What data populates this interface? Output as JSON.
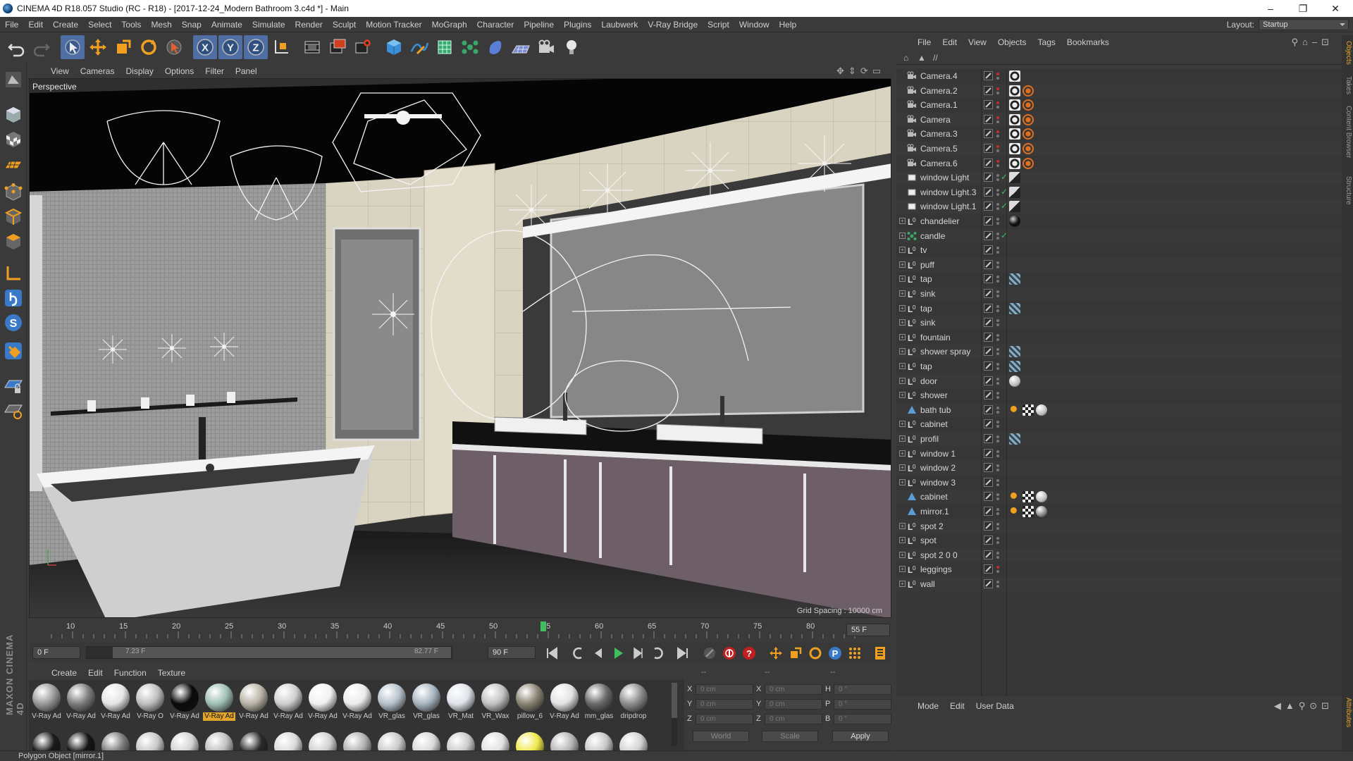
{
  "window": {
    "title": "CINEMA 4D R18.057 Studio (RC - R18) - [2017-12-24_Modern Bathroom 3.c4d *] - Main",
    "controls": [
      "–",
      "❐",
      "✕"
    ]
  },
  "menu": [
    "File",
    "Edit",
    "Create",
    "Select",
    "Tools",
    "Mesh",
    "Snap",
    "Animate",
    "Simulate",
    "Render",
    "Sculpt",
    "Motion Tracker",
    "MoGraph",
    "Character",
    "Pipeline",
    "Plugins",
    "Laubwerk",
    "V-Ray Bridge",
    "Script",
    "Window",
    "Help"
  ],
  "layout": {
    "label": "Layout:",
    "value": "Startup"
  },
  "toolbar": {
    "icons": [
      "undo-icon",
      "redo-icon",
      "live-selection-icon",
      "move-icon",
      "scale-icon",
      "rotate-icon",
      "recent-tool-icon",
      "x-axis-icon",
      "y-axis-icon",
      "z-axis-icon",
      "coordinate-system-icon",
      "render-view-icon",
      "render-picture-viewer-icon",
      "edit-render-settings-icon",
      "cube-icon",
      "pen-spline-icon",
      "subdivision-surface-icon",
      "cloner-icon",
      "deformer-icon",
      "floor-icon",
      "camera-icon",
      "light-icon"
    ],
    "axis_labels": [
      "X",
      "Y",
      "Z"
    ]
  },
  "viewport": {
    "menu": [
      "View",
      "Cameras",
      "Display",
      "Options",
      "Filter",
      "Panel"
    ],
    "label": "Perspective",
    "grid_spacing": "Grid Spacing : 10000 cm"
  },
  "timeline": {
    "ticks": [
      "10",
      "15",
      "20",
      "25",
      "30",
      "35",
      "40",
      "45",
      "50",
      "55",
      "60",
      "65",
      "70",
      "75",
      "80"
    ],
    "current_frame": "55 F",
    "start": "0 F",
    "range_start": "7.23 F",
    "range_end": "82.77 F",
    "end": "90 F"
  },
  "materials": {
    "menu": [
      "Create",
      "Edit",
      "Function",
      "Texture"
    ],
    "row1": [
      {
        "label": "V-Ray Ad",
        "color": "#9a9a9a",
        "selected": false
      },
      {
        "label": "V-Ray Ad",
        "color": "#7d7d7d",
        "selected": false
      },
      {
        "label": "V-Ray Ad",
        "color": "#e6e6e6",
        "selected": false
      },
      {
        "label": "V-Ray O",
        "color": "#bfbfbf",
        "selected": false
      },
      {
        "label": "V-Ray Ad",
        "color": "#0a0a0a",
        "selected": false
      },
      {
        "label": "V-Ray Ad",
        "color": "#9fbfb5",
        "selected": true
      },
      {
        "label": "V-Ray Ad",
        "color": "#b9b4a6",
        "selected": false
      },
      {
        "label": "V-Ray Ad",
        "color": "#cfcfcf",
        "selected": false
      },
      {
        "label": "V-Ray Ad",
        "color": "#f1f1f1",
        "selected": false
      },
      {
        "label": "V-Ray Ad",
        "color": "#ececec",
        "selected": false
      },
      {
        "label": "VR_glas",
        "color": "#b6c2cc",
        "selected": false
      },
      {
        "label": "VR_glas",
        "color": "#a9b6c0",
        "selected": false
      },
      {
        "label": "VR_Mat",
        "color": "#dfe4ea",
        "selected": false
      },
      {
        "label": "VR_Wax",
        "color": "#c2c2c2",
        "selected": false
      },
      {
        "label": "pillow_6",
        "color": "#8a8474",
        "selected": false
      },
      {
        "label": "V-Ray Ad",
        "color": "#e2e2e2",
        "selected": false
      },
      {
        "label": "mm_glas",
        "color": "#6a6a6a",
        "selected": false
      },
      {
        "label": "dripdrop",
        "color": "#8d8d8d",
        "selected": false
      }
    ],
    "row2_colors": [
      "#1a1a1a",
      "#141414",
      "#7b7b7b",
      "#c7c7c7",
      "#d3d3d3",
      "#bfbfbf",
      "#2a2a2a",
      "#dadada",
      "#cfcfcf",
      "#b0b0b0",
      "#c9c9c9",
      "#d8d8d8",
      "#cacaca",
      "#e0e0e0",
      "#f0e94a",
      "#b5b5b5",
      "#c8c8c8",
      "#d2d2d2"
    ]
  },
  "coords": {
    "header": [
      "--",
      "--",
      "--"
    ],
    "rows": [
      {
        "a": "X",
        "av": "0 cm",
        "b": "X",
        "bv": "0 cm",
        "c": "H",
        "cv": "0 °"
      },
      {
        "a": "Y",
        "av": "0 cm",
        "b": "Y",
        "bv": "0 cm",
        "c": "P",
        "cv": "0 °"
      },
      {
        "a": "Z",
        "av": "0 cm",
        "b": "Z",
        "bv": "0 cm",
        "c": "B",
        "cv": "0 °"
      }
    ],
    "mode1": "World",
    "mode2": "Scale",
    "apply": "Apply"
  },
  "objects": {
    "menu": [
      "File",
      "Edit",
      "View",
      "Objects",
      "Tags",
      "Bookmarks"
    ],
    "path": "//",
    "items": [
      {
        "name": "Camera.4",
        "type": "camera",
        "expand": false,
        "tags": [
          "camera"
        ]
      },
      {
        "name": "Camera.2",
        "type": "camera",
        "expand": false,
        "tags": [
          "camera",
          "protect"
        ]
      },
      {
        "name": "Camera.1",
        "type": "camera",
        "expand": false,
        "tags": [
          "camera",
          "protect"
        ]
      },
      {
        "name": "Camera",
        "type": "camera",
        "expand": false,
        "tags": [
          "camera",
          "protect"
        ]
      },
      {
        "name": "Camera.3",
        "type": "camera",
        "expand": false,
        "tags": [
          "camera",
          "protect"
        ]
      },
      {
        "name": "Camera.5",
        "type": "camera",
        "expand": false,
        "tags": [
          "camera",
          "protect"
        ]
      },
      {
        "name": "Camera.6",
        "type": "camera",
        "expand": false,
        "tags": [
          "camera",
          "protect"
        ]
      },
      {
        "name": "window Light",
        "type": "light",
        "expand": false,
        "tags": [
          "vray-light"
        ]
      },
      {
        "name": "window Light.3",
        "type": "light",
        "expand": false,
        "tags": [
          "vray-light"
        ]
      },
      {
        "name": "window Light.1",
        "type": "light",
        "expand": false,
        "tags": [
          "vray-light"
        ]
      },
      {
        "name": "chandelier",
        "type": "null",
        "expand": true,
        "tags": [
          "material-black"
        ]
      },
      {
        "name": "candle",
        "type": "cloner",
        "expand": true,
        "tags": []
      },
      {
        "name": "tv",
        "type": "null",
        "expand": true,
        "tags": []
      },
      {
        "name": "puff",
        "type": "null",
        "expand": true,
        "tags": []
      },
      {
        "name": "tap",
        "type": "null",
        "expand": true,
        "tags": [
          "texture"
        ]
      },
      {
        "name": "sink",
        "type": "null",
        "expand": true,
        "tags": []
      },
      {
        "name": "tap",
        "type": "null",
        "expand": true,
        "tags": [
          "texture"
        ]
      },
      {
        "name": "sink",
        "type": "null",
        "expand": true,
        "tags": []
      },
      {
        "name": "fountain",
        "type": "null",
        "expand": true,
        "tags": []
      },
      {
        "name": "shower spray",
        "type": "null",
        "expand": true,
        "tags": [
          "texture"
        ]
      },
      {
        "name": "tap",
        "type": "null",
        "expand": true,
        "tags": [
          "texture"
        ]
      },
      {
        "name": "door",
        "type": "null",
        "expand": true,
        "tags": [
          "material-white"
        ]
      },
      {
        "name": "shower",
        "type": "null",
        "expand": true,
        "tags": []
      },
      {
        "name": "bath tub",
        "type": "polygon",
        "expand": false,
        "tags": [
          "phong",
          "checker",
          "material-white"
        ]
      },
      {
        "name": "cabinet",
        "type": "null",
        "expand": true,
        "tags": []
      },
      {
        "name": "profil",
        "type": "null",
        "expand": true,
        "tags": [
          "texture"
        ]
      },
      {
        "name": "window 1",
        "type": "null",
        "expand": true,
        "tags": []
      },
      {
        "name": "window 2",
        "type": "null",
        "expand": true,
        "tags": []
      },
      {
        "name": "window 3",
        "type": "null",
        "expand": true,
        "tags": []
      },
      {
        "name": "cabinet",
        "type": "polygon",
        "expand": false,
        "tags": [
          "phong",
          "checker",
          "material-white"
        ]
      },
      {
        "name": "mirror.1",
        "type": "polygon",
        "expand": false,
        "tags": [
          "phong",
          "checker",
          "material-grey"
        ]
      },
      {
        "name": "spot 2",
        "type": "null",
        "expand": true,
        "tags": []
      },
      {
        "name": "spot",
        "type": "null",
        "expand": true,
        "tags": []
      },
      {
        "name": "spot 2 0 0",
        "type": "null",
        "expand": true,
        "tags": []
      },
      {
        "name": "leggings",
        "type": "null",
        "expand": true,
        "tags": []
      },
      {
        "name": "wall",
        "type": "null",
        "expand": true,
        "tags": []
      }
    ]
  },
  "attributes": {
    "menu": [
      "Mode",
      "Edit",
      "User Data"
    ]
  },
  "right_tabs": [
    "Objects",
    "Takes",
    "Content Browser",
    "Structure",
    "Attributes"
  ],
  "status": "Polygon Object [mirror.1]",
  "logo": "MAXON CINEMA 4D",
  "colors": {
    "accent": "#4f6ea3",
    "selected_material": "#e0a52a",
    "timeline_marker": "#3fbf5f"
  }
}
